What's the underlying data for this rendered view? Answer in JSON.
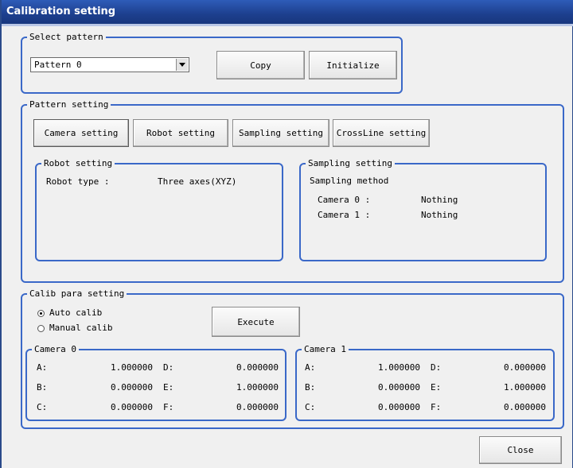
{
  "window": {
    "title": "Calibration setting"
  },
  "select_pattern": {
    "title": "Select pattern",
    "selected": "Pattern 0",
    "copy_label": "Copy",
    "initialize_label": "Initialize"
  },
  "pattern_setting": {
    "title": "Pattern setting",
    "tabs": [
      "Camera setting",
      "Robot setting",
      "Sampling setting",
      "CrossLine setting"
    ],
    "robot": {
      "title": "Robot setting",
      "type_label": "Robot type :",
      "type_value": "Three axes(XYZ)"
    },
    "sampling": {
      "title": "Sampling setting",
      "method_label": "Sampling method",
      "camera0_label": "Camera 0 :",
      "camera0_value": "Nothing",
      "camera1_label": "Camera 1 :",
      "camera1_value": "Nothing"
    }
  },
  "calib": {
    "title": "Calib para setting",
    "auto_label": "Auto calib",
    "manual_label": "Manual calib",
    "selected": "auto",
    "execute_label": "Execute",
    "camera0": {
      "title": "Camera 0",
      "rows": [
        {
          "l1": "A:",
          "v1": "1.000000",
          "l2": "D:",
          "v2": "0.000000"
        },
        {
          "l1": "B:",
          "v1": "0.000000",
          "l2": "E:",
          "v2": "1.000000"
        },
        {
          "l1": "C:",
          "v1": "0.000000",
          "l2": "F:",
          "v2": "0.000000"
        }
      ]
    },
    "camera1": {
      "title": "Camera 1",
      "rows": [
        {
          "l1": "A:",
          "v1": "1.000000",
          "l2": "D:",
          "v2": "0.000000"
        },
        {
          "l1": "B:",
          "v1": "0.000000",
          "l2": "E:",
          "v2": "1.000000"
        },
        {
          "l1": "C:",
          "v1": "0.000000",
          "l2": "F:",
          "v2": "0.000000"
        }
      ]
    }
  },
  "footer": {
    "close_label": "Close"
  }
}
